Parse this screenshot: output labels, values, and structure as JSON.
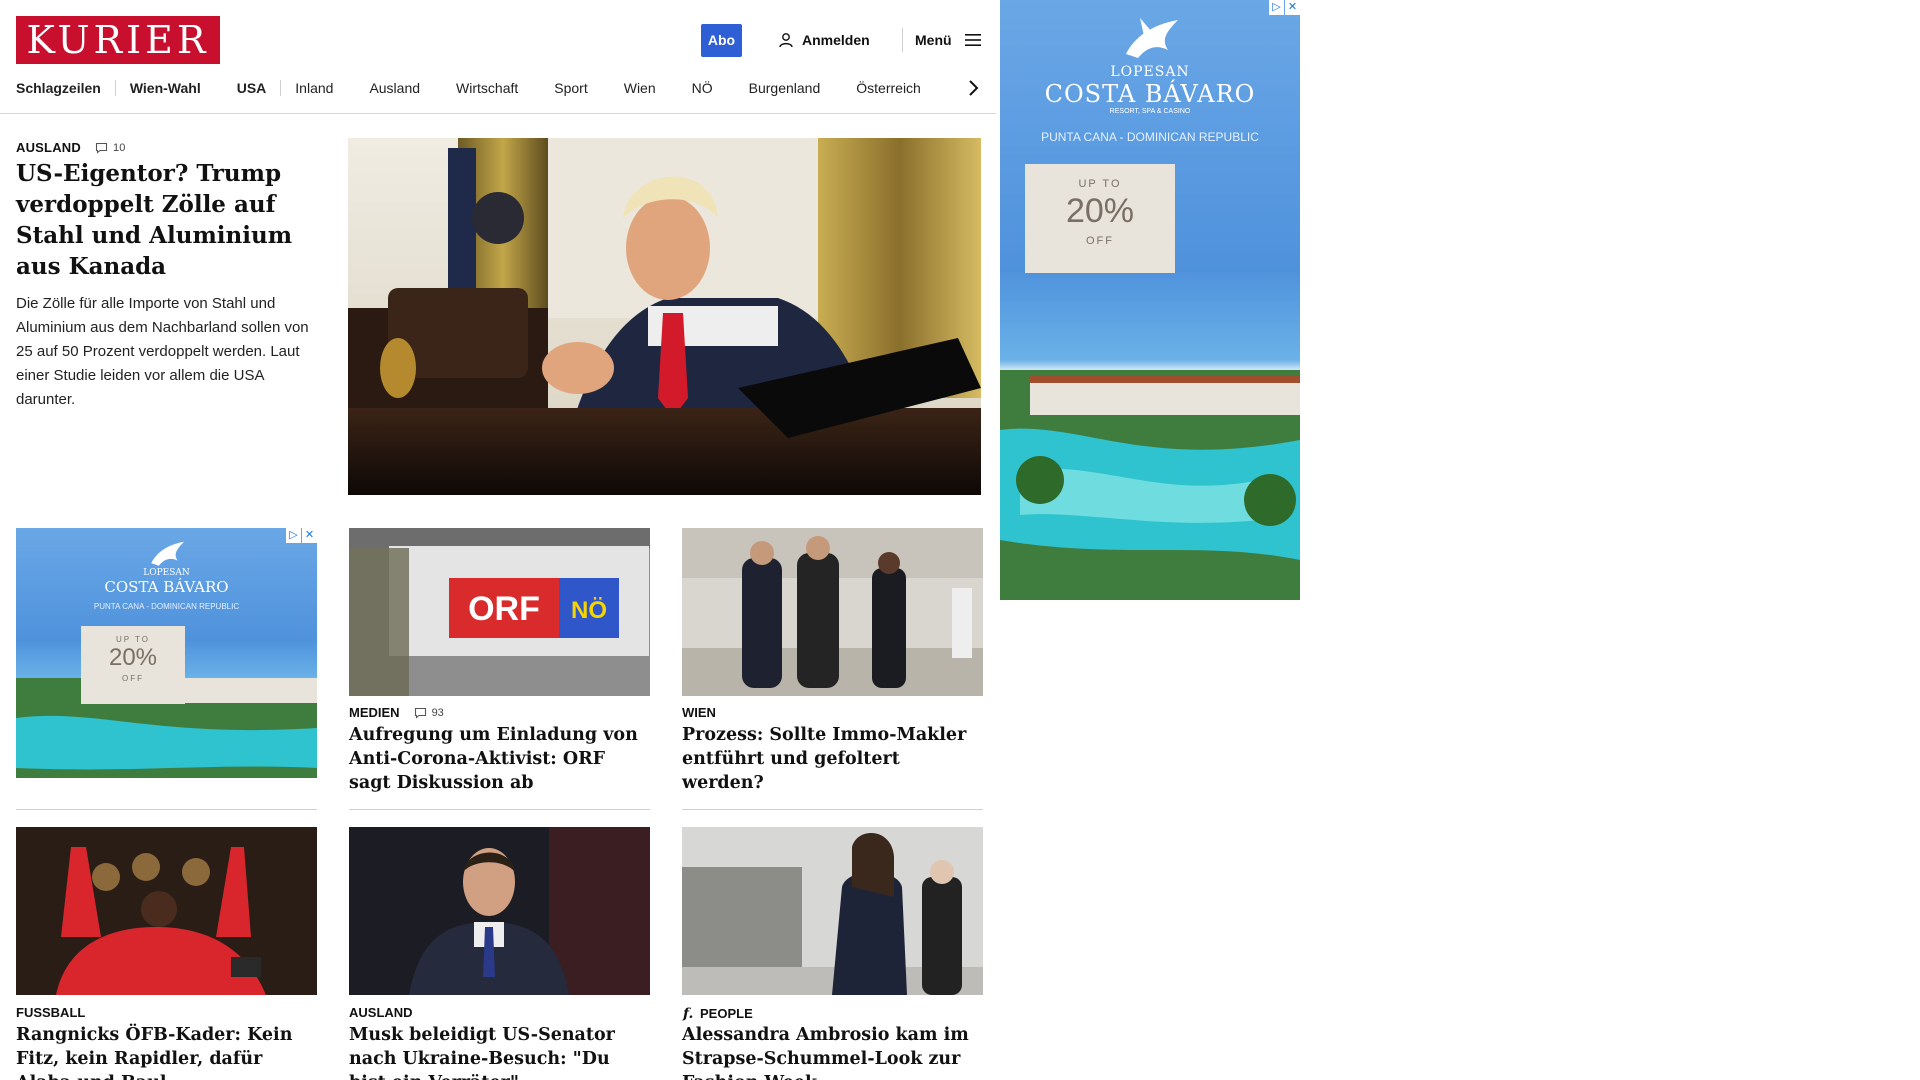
{
  "header": {
    "logo": "KURIER",
    "abo_label": "Abo",
    "login_label": "Anmelden",
    "menu_label": "Menü"
  },
  "nav": {
    "items": [
      "Schlagzeilen",
      "Wien-Wahl",
      "USA",
      "Inland",
      "Ausland",
      "Wirtschaft",
      "Sport",
      "Wien",
      "NÖ",
      "Burgenland",
      "Österreich"
    ]
  },
  "lead": {
    "category": "AUSLAND",
    "comments": "10",
    "title": "US-Eigentor? Trump verdoppelt Zölle auf Stahl und Aluminium aus Kanada",
    "teaser": "Die Zölle für alle Importe von Stahl und Aluminium aus dem Nachbarland sollen von 25 auf 50 Prozent verdoppelt werden. Laut einer Studie leiden vor allem die USA darunter."
  },
  "ads": {
    "brand_top": "LOPESAN",
    "brand_main": "COSTA BÁVARO",
    "brand_sub": "RESORT, SPA & CASINO",
    "location": "PUNTA CANA - DOMINICAN REPUBLIC",
    "offer_up_to": "UP TO",
    "offer_percent": "20%",
    "offer_off": "OFF"
  },
  "cards": [
    {
      "category": "MEDIEN",
      "comments": "93",
      "title": "Aufregung um Einladung von Anti-Corona-Aktivist: ORF sagt Diskussion ab",
      "image_text_left": "ORF",
      "image_text_right": "NÖ"
    },
    {
      "category": "WIEN",
      "title": "Prozess: Sollte Immo-Makler entführt und gefoltert werden?"
    },
    {
      "category": "FUSSBALL",
      "title": "Rangnicks ÖFB-Kader: Kein Fitz, kein Rapidler, dafür Alaba und Baul"
    },
    {
      "category": "AUSLAND",
      "title": "Musk beleidigt US-Senator nach Ukraine-Besuch: \"Du bist ein Verräter\""
    },
    {
      "category": "PEOPLE",
      "title": "Alessandra Ambrosio kam im Strapse-Schummel-Look zur Fashion Week"
    }
  ]
}
